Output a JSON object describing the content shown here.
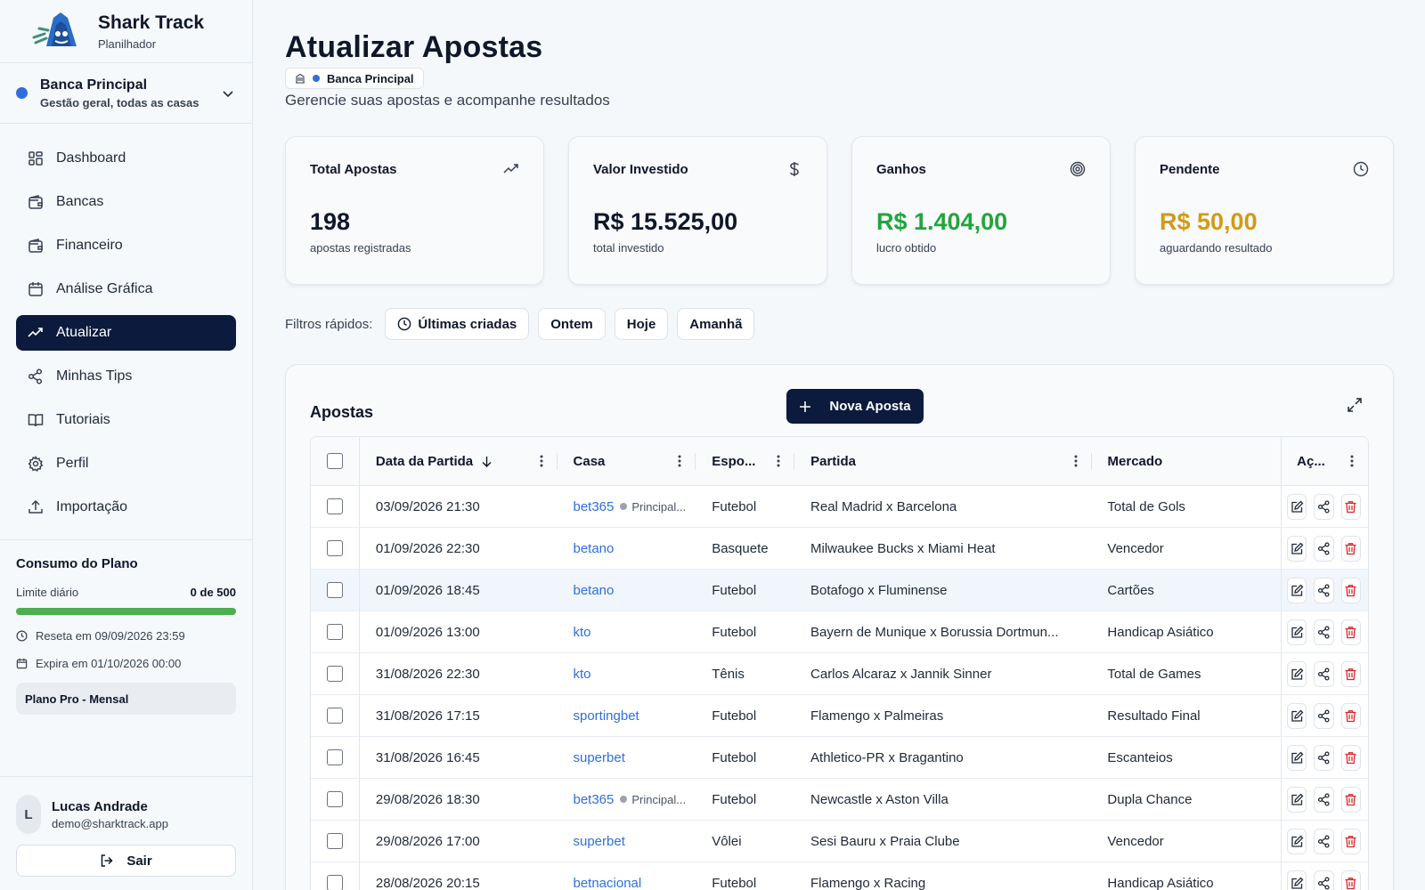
{
  "brand": {
    "title": "Shark Track",
    "subtitle": "Planilhador"
  },
  "bank": {
    "name": "Banca Principal",
    "description": "Gestão geral, todas as casas",
    "color": "#2f6fdc"
  },
  "nav": [
    {
      "label": "Dashboard",
      "icon": "dashboard-icon"
    },
    {
      "label": "Bancas",
      "icon": "wallet-icon"
    },
    {
      "label": "Financeiro",
      "icon": "wallet-icon"
    },
    {
      "label": "Análise Gráfica",
      "icon": "calendar-icon"
    },
    {
      "label": "Atualizar",
      "icon": "trending-up-icon",
      "active": true
    },
    {
      "label": "Minhas Tips",
      "icon": "share-icon"
    },
    {
      "label": "Tutoriais",
      "icon": "book-icon"
    },
    {
      "label": "Perfil",
      "icon": "gear-icon"
    },
    {
      "label": "Importação",
      "icon": "upload-icon"
    }
  ],
  "plan": {
    "title": "Consumo do Plano",
    "limit_label": "Limite diário",
    "limit_value": "0 de 500",
    "progress": 1.0,
    "reset": "Reseta em 09/09/2026 23:59",
    "expires": "Expira em 01/10/2026 00:00",
    "plan_name": "Plano Pro - Mensal"
  },
  "user": {
    "initial": "L",
    "name": "Lucas Andrade",
    "email": "demo@sharktrack.app",
    "logout_label": "Sair"
  },
  "page": {
    "title": "Atualizar Apostas",
    "chip": "Banca Principal",
    "subtitle": "Gerencie suas apostas e acompanhe resultados"
  },
  "cards": [
    {
      "title": "Total Apostas",
      "value": "198",
      "sub": "apostas registradas",
      "icon": "trending-up-icon",
      "color": "#0f172a"
    },
    {
      "title": "Valor Investido",
      "value": "R$ 15.525,00",
      "sub": "total investido",
      "icon": "dollar-icon",
      "color": "#0f172a"
    },
    {
      "title": "Ganhos",
      "value": "R$ 1.404,00",
      "sub": "lucro obtido",
      "icon": "target-icon",
      "color": "#22a53c"
    },
    {
      "title": "Pendente",
      "value": "R$ 50,00",
      "sub": "aguardando resultado",
      "icon": "clock-icon",
      "color": "#d49a12"
    }
  ],
  "filters": {
    "label": "Filtros rápidos:",
    "buttons": [
      "Últimas criadas",
      "Ontem",
      "Hoje",
      "Amanhã"
    ]
  },
  "table": {
    "title": "Apostas",
    "new_button": "Nova Aposta",
    "columns": [
      "Data da Partida",
      "Casa",
      "Espo...",
      "Partida",
      "Mercado",
      "Aç..."
    ],
    "rows": [
      {
        "date": "03/09/2026 21:30",
        "casa": "bet365",
        "tag": "Principal...",
        "esporte": "Futebol",
        "partida": "Real Madrid x Barcelona",
        "mercado": "Total de Gols"
      },
      {
        "date": "01/09/2026 22:30",
        "casa": "betano",
        "tag": "",
        "esporte": "Basquete",
        "partida": "Milwaukee Bucks x Miami Heat",
        "mercado": "Vencedor"
      },
      {
        "date": "01/09/2026 18:45",
        "casa": "betano",
        "tag": "",
        "esporte": "Futebol",
        "partida": "Botafogo x Fluminense",
        "mercado": "Cartões",
        "highlight": true
      },
      {
        "date": "01/09/2026 13:00",
        "casa": "kto",
        "tag": "",
        "esporte": "Futebol",
        "partida": "Bayern de Munique x Borussia Dortmun...",
        "mercado": "Handicap Asiático"
      },
      {
        "date": "31/08/2026 22:30",
        "casa": "kto",
        "tag": "",
        "esporte": "Tênis",
        "partida": "Carlos Alcaraz x Jannik Sinner",
        "mercado": "Total de Games"
      },
      {
        "date": "31/08/2026 17:15",
        "casa": "sportingbet",
        "tag": "",
        "esporte": "Futebol",
        "partida": "Flamengo x Palmeiras",
        "mercado": "Resultado Final"
      },
      {
        "date": "31/08/2026 16:45",
        "casa": "superbet",
        "tag": "",
        "esporte": "Futebol",
        "partida": "Athletico-PR x Bragantino",
        "mercado": "Escanteios"
      },
      {
        "date": "29/08/2026 18:30",
        "casa": "bet365",
        "tag": "Principal...",
        "esporte": "Futebol",
        "partida": "Newcastle x Aston Villa",
        "mercado": "Dupla Chance"
      },
      {
        "date": "29/08/2026 17:00",
        "casa": "superbet",
        "tag": "",
        "esporte": "Vôlei",
        "partida": "Sesi Bauru x Praia Clube",
        "mercado": "Vencedor"
      },
      {
        "date": "28/08/2026 20:15",
        "casa": "betnacional",
        "tag": "",
        "esporte": "Futebol",
        "partida": "Flamengo x Racing",
        "mercado": "Handicap Asiático"
      }
    ]
  }
}
